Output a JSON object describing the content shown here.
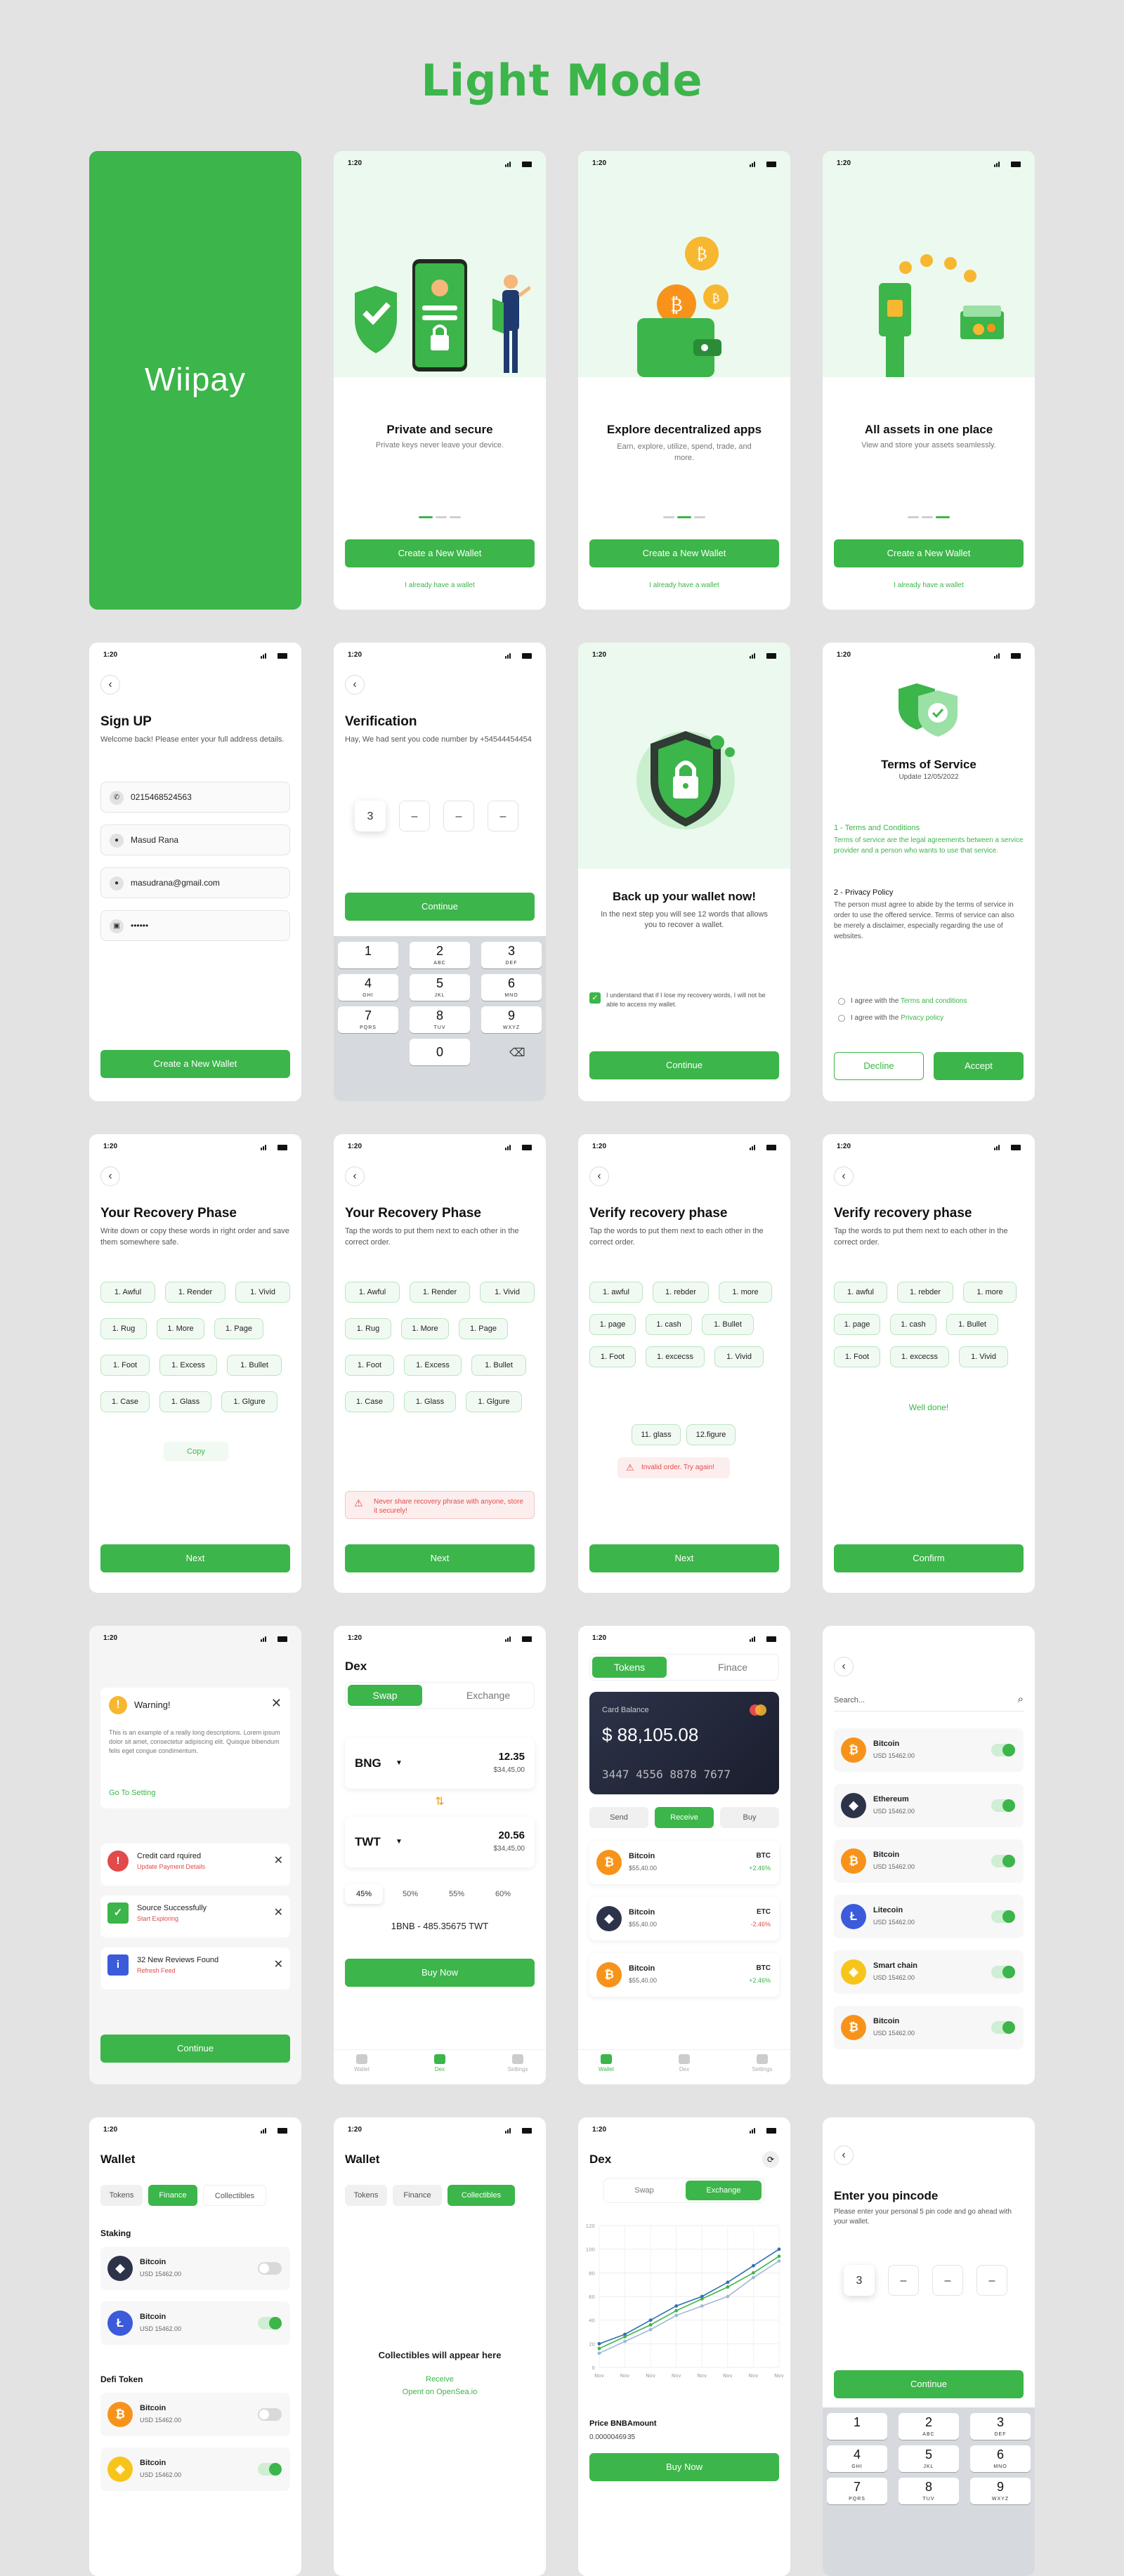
{
  "page_title": "Light Mode",
  "status_time": "1:20",
  "brand": "Wiipay",
  "onboarding": [
    {
      "title": "Private and secure",
      "desc": "Private keys never leave your device.",
      "cta": "Create a New Wallet",
      "link": "I already have a wallet"
    },
    {
      "title": "Explore decentralized apps",
      "desc": "Earn, explore, utilize, spend, trade, and more.",
      "cta": "Create a New Wallet",
      "link": "I already have a wallet"
    },
    {
      "title": "All assets in one place",
      "desc": "View and store your assets seamlessly.",
      "cta": "Create a New Wallet",
      "link": "I already have a wallet"
    }
  ],
  "signup": {
    "title": "Sign UP",
    "desc": "Welcome back! Please enter your full address details.",
    "phone": "0215468524563",
    "name": "Masud Rana",
    "email": "masudrana@gmail.com",
    "password": "••••••",
    "cta": "Create a New Wallet"
  },
  "verification": {
    "title": "Verification",
    "desc": "Hay, We had sent you code number by +54544454454",
    "digits": [
      "3",
      "–",
      "–",
      "–"
    ],
    "cta": "Continue"
  },
  "keypad": [
    {
      "d": "1",
      "l": ""
    },
    {
      "d": "2",
      "l": "ABC"
    },
    {
      "d": "3",
      "l": "DEF"
    },
    {
      "d": "4",
      "l": "GHI"
    },
    {
      "d": "5",
      "l": "JKL"
    },
    {
      "d": "6",
      "l": "MNO"
    },
    {
      "d": "7",
      "l": "PQRS"
    },
    {
      "d": "8",
      "l": "TUV"
    },
    {
      "d": "9",
      "l": "WXYZ"
    },
    {
      "d": "0",
      "l": ""
    }
  ],
  "backup": {
    "title": "Back up your wallet now!",
    "desc": "In the next step you will see 12 words that allows you to recover a wallet.",
    "check": "I understand that if I lose my recovery words, I will not be able to access my wallet.",
    "cta": "Continue"
  },
  "terms": {
    "title": "Terms of Service",
    "update": "Update 12/05/2022",
    "s1": "1 - Terms and Conditions",
    "s1_text": "Terms of service are the legal agreements between a service provider and a person who wants to use that service.",
    "s2": "2 - Privacy Policy",
    "s2_text": "The person must agree to abide by the terms of service in order to use the offered service. Terms of service can also be merely a disclaimer, especially regarding the use of websites.",
    "agree1_pre": "I agree with the ",
    "agree1_link": "Terms and conditions",
    "agree2_pre": "I agree with the ",
    "agree2_link": "Privacy policy",
    "decline": "Decline",
    "accept": "Accept"
  },
  "recovery1": {
    "title": "Your Recovery Phase",
    "desc": "Write down or copy these words in right order and save them somewhere safe.",
    "words": [
      "1. Awful",
      "1. Render",
      "1. Vivid",
      "1. Rug",
      "1. More",
      "1. Page",
      "1. Foot",
      "1. Excess",
      "1. Bullet",
      "1. Case",
      "1. Glass",
      "1. Glgure"
    ],
    "copy": "Copy",
    "cta": "Next"
  },
  "recovery2": {
    "title": "Your Recovery Phase",
    "desc": "Tap the words to put them next to each other in the correct order.",
    "words": [
      "1. Awful",
      "1. Render",
      "1. Vivid",
      "1. Rug",
      "1. More",
      "1. Page",
      "1. Foot",
      "1. Excess",
      "1. Bullet",
      "1. Case",
      "1. Glass",
      "1. Glgure"
    ],
    "warning": "Never share recovery phrase with anyone, store it securely!",
    "cta": "Next"
  },
  "verify1": {
    "title": "Verify recovery phase",
    "desc": "Tap the words to put them next to each other in the correct order.",
    "words": [
      "1. awful",
      "1. rebder",
      "1. more",
      "1. page",
      "1. cash",
      "1. Bullet",
      "1. Foot",
      "1. excecss",
      "1. Vivid"
    ],
    "picked": [
      "11. glass",
      "12.figure"
    ],
    "error": "Invalid order. Try again!",
    "cta": "Next"
  },
  "verify2": {
    "title": "Verify recovery phase",
    "desc": "Tap the words to put them next to each other in the correct order.",
    "words": [
      "1. awful",
      "1. rebder",
      "1. more",
      "1. page",
      "1. cash",
      "1. Bullet",
      "1. Foot",
      "1. excecss",
      "1. Vivid"
    ],
    "success": "Well done!",
    "cta": "Confirm"
  },
  "warning_screen": {
    "title": "Warning!",
    "text": "This is an example of a really long descriptions. Lorem ipsum dolor sit amet, consectetur adipiscing elit. Quisque bibendum felis eget congue condimentum.",
    "link": "Go To Setting",
    "notifs": [
      {
        "t": "Credit card rquired",
        "s": "Update Payment Details"
      },
      {
        "t": "Source Successfully",
        "s": "Start Exploring"
      },
      {
        "t": "32 New Reviews Found",
        "s": "Refresh Feed"
      }
    ],
    "cta": "Continue"
  },
  "dex": {
    "title": "Dex",
    "tab_swap": "Swap",
    "tab_exchange": "Exchange",
    "from_token": "BNG",
    "from_amount": "12.35",
    "from_usd": "$34,45,00",
    "to_token": "TWT",
    "to_amount": "20.56",
    "to_usd": "$34,45,00",
    "percents": [
      "45%",
      "50%",
      "55%",
      "60%"
    ],
    "rate": "1BNB - 485.35675 TWT",
    "cta": "Buy Now",
    "nav": [
      "Wallet",
      "Dex",
      "Settings"
    ]
  },
  "tokens": {
    "tab_tokens": "Tokens",
    "tab_finance": "Finace",
    "card_label": "Card Balance",
    "balance": "$ 88,105.08",
    "card_number": "3447  4556  8878  7677",
    "actions": [
      "Send",
      "Receive",
      "Buy"
    ],
    "list": [
      {
        "name": "Bitcoin",
        "sub": "$55,40.00",
        "sym": "BTC",
        "chg": "+2.46%"
      },
      {
        "name": "Bitcoin",
        "sub": "$55,40.00",
        "sym": "ETC",
        "chg": "-2.46%"
      },
      {
        "name": "Bitcoin",
        "sub": "$55,40.00",
        "sym": "BTC",
        "chg": "+2.46%"
      }
    ],
    "nav": [
      "Wallet",
      "Dex",
      "Settings"
    ]
  },
  "search_list": {
    "placeholder": "Search...",
    "items": [
      {
        "name": "Bitcoin",
        "sub": "USD 15462.00"
      },
      {
        "name": "Ethereum",
        "sub": "USD 15462.00"
      },
      {
        "name": "Bitcoin",
        "sub": "USD 15462.00"
      },
      {
        "name": "Litecoin",
        "sub": "USD 15462.00"
      },
      {
        "name": "Smart chain",
        "sub": "USD 15462.00"
      },
      {
        "name": "Bitcoin",
        "sub": "USD 15462.00"
      }
    ]
  },
  "wallet_finance": {
    "title": "Wallet",
    "tabs": [
      "Tokens",
      "Finance",
      "Collectibles"
    ],
    "staking": "Staking",
    "defi": "Defi Token",
    "staking_items": [
      {
        "name": "Bitcoin",
        "sub": "USD 15462.00"
      },
      {
        "name": "Bitcoin",
        "sub": "USD 15462.00"
      }
    ],
    "defi_items": [
      {
        "name": "Bitcoin",
        "sub": "USD 15462.00"
      },
      {
        "name": "Bitcoin",
        "sub": "USD 15462.00"
      }
    ]
  },
  "wallet_collect": {
    "title": "Wallet",
    "tabs": [
      "Tokens",
      "Finance",
      "Collectibles"
    ],
    "empty": "Collectibles will appear here",
    "receive": "Receive",
    "opensea": "Opent on OpenSea.io"
  },
  "dex_chart": {
    "title": "Dex",
    "tab_swap": "Swap",
    "tab_exchange": "Exchange",
    "price_label": "Price BNB",
    "amount_label": "Amount",
    "price": "0.00000469",
    "amount": "35",
    "cta": "Buy Now"
  },
  "chart_data": {
    "type": "line",
    "categories": [
      "Nov",
      "Nov",
      "Nov",
      "Nov",
      "Nov",
      "Nov",
      "Nov",
      "Nov"
    ],
    "y_ticks": [
      "120",
      "100",
      "80",
      "60",
      "40",
      "20",
      "0"
    ],
    "ylim": [
      0,
      120
    ],
    "series": [
      {
        "values": [
          20,
          28,
          40,
          52,
          60,
          72,
          86,
          100
        ]
      },
      {
        "values": [
          16,
          26,
          36,
          48,
          58,
          68,
          80,
          94
        ]
      },
      {
        "values": [
          12,
          22,
          32,
          44,
          52,
          60,
          76,
          90
        ]
      }
    ]
  },
  "pincode": {
    "title": "Enter you pincode",
    "desc": "Please enter your personal 5 pin code and go ahead with your wallet.",
    "digits": [
      "3",
      "–",
      "–",
      "–"
    ],
    "cta": "Continue"
  },
  "colors": {
    "accent": "#3cb54a",
    "danger": "#e24b4b",
    "bitcoin": "#f7931a"
  }
}
